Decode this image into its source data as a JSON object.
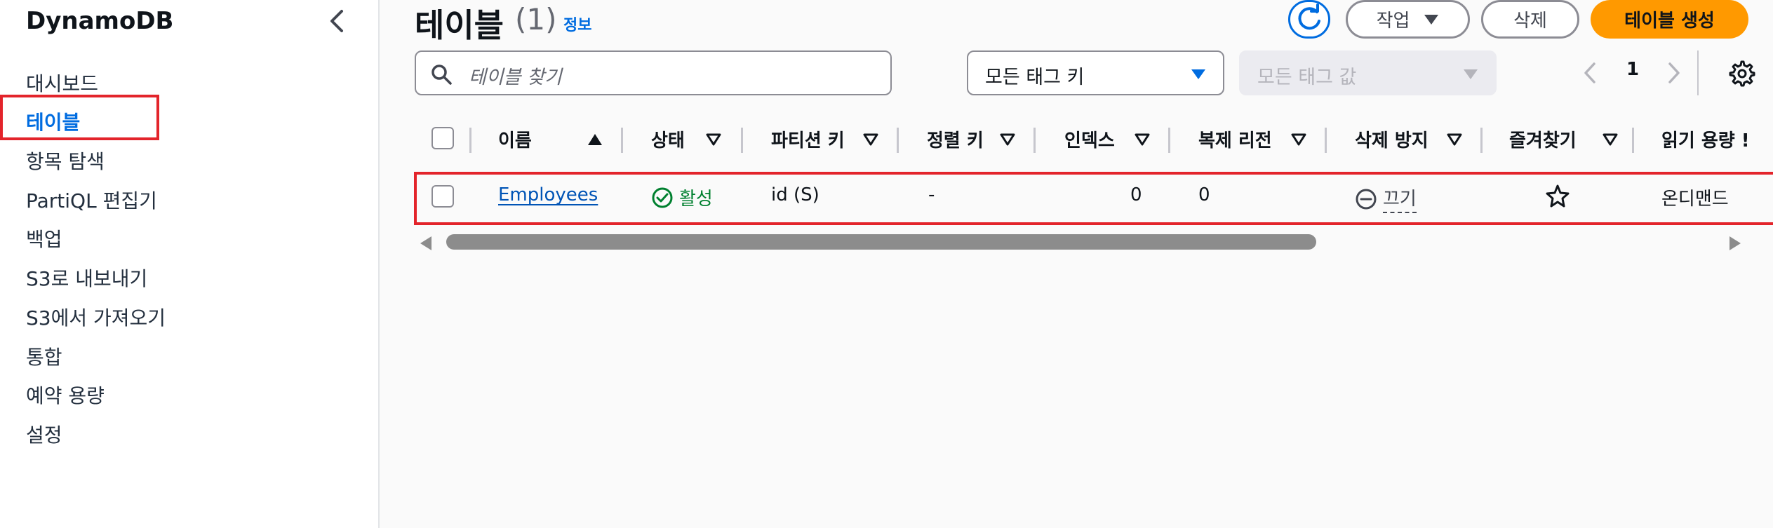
{
  "sidebar": {
    "brand": "DynamoDB",
    "items": [
      {
        "label": "대시보드"
      },
      {
        "label": "테이블",
        "active": true
      },
      {
        "label": "항목 탐색"
      },
      {
        "label": "PartiQL 편집기"
      },
      {
        "label": "백업"
      },
      {
        "label": "S3로 내보내기"
      },
      {
        "label": "S3에서 가져오기"
      },
      {
        "label": "통합"
      },
      {
        "label": "예약 용량"
      },
      {
        "label": "설정"
      }
    ]
  },
  "header": {
    "title": "테이블",
    "count": "(1)",
    "info_link": "정보",
    "actions_label": "작업",
    "delete_label": "삭제",
    "create_label": "테이블 생성"
  },
  "filters": {
    "search_placeholder": "테이블 찾기",
    "tag_key_select": "모든 태그 키",
    "tag_value_select": "모든 태그 값"
  },
  "pagination": {
    "current_page": "1"
  },
  "table": {
    "columns": [
      "이름",
      "상태",
      "파티션 키",
      "정렬 키",
      "인덱스",
      "복제 리전",
      "삭제 방지",
      "즐겨찾기",
      "읽기 용량 !"
    ],
    "rows": [
      {
        "name": "Employees",
        "status": "활성",
        "partition_key": "id (S)",
        "sort_key": "-",
        "indexes": "0",
        "replica_regions": "0",
        "deletion_protection": "끄기",
        "read_capacity": "온디맨드"
      }
    ]
  },
  "colors": {
    "accent": "#006ce0",
    "primary_button": "#ff9900",
    "success": "#00802f",
    "highlight": "#e3242b"
  }
}
